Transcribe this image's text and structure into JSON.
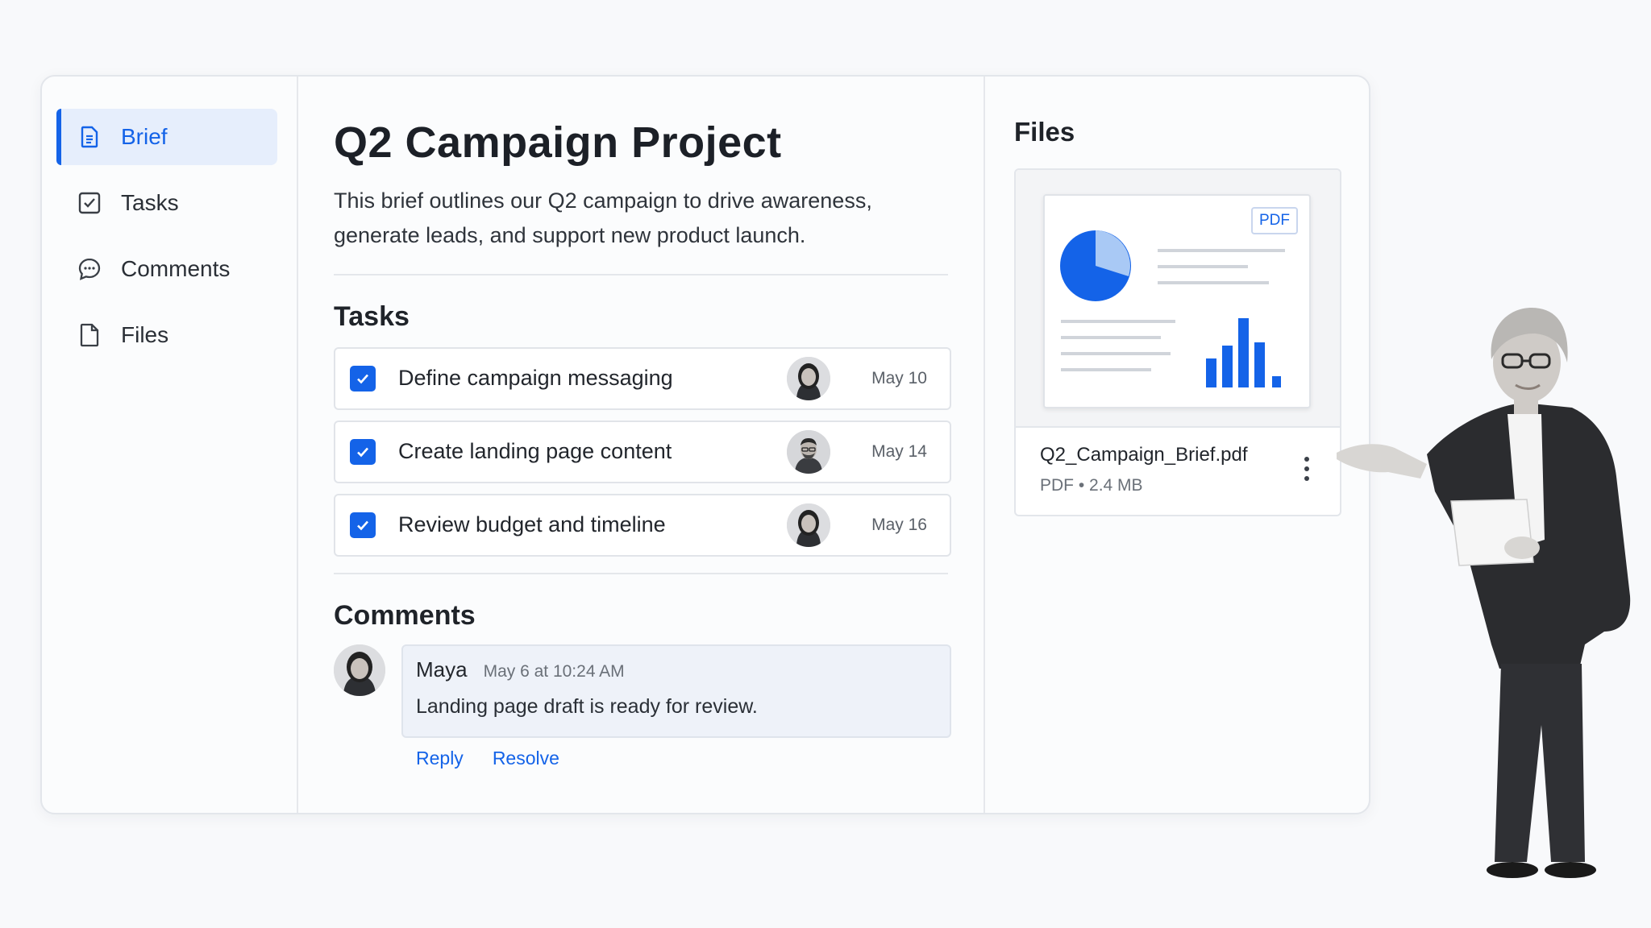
{
  "sidebar": {
    "items": [
      {
        "label": "Brief",
        "icon": "document-icon",
        "active": true
      },
      {
        "label": "Tasks",
        "icon": "checkbox-icon",
        "active": false
      },
      {
        "label": "Comments",
        "icon": "chat-bubble-icon",
        "active": false
      },
      {
        "label": "Files",
        "icon": "file-icon",
        "active": false
      }
    ]
  },
  "main": {
    "title": "Q2 Campaign Project",
    "description": "This brief outlines our Q2 campaign to drive awareness, generate leads, and support new product launch.",
    "tasks_heading": "Tasks",
    "tasks": [
      {
        "label": "Define campaign messaging",
        "date": "May 10",
        "done": true,
        "avatar": "woman-avatar"
      },
      {
        "label": "Create landing page content",
        "date": "May 14",
        "done": true,
        "avatar": "man-avatar"
      },
      {
        "label": "Review budget and timeline",
        "date": "May 16",
        "done": true,
        "avatar": "woman-avatar"
      }
    ],
    "comments_heading": "Comments",
    "comment": {
      "author": "Maya",
      "time": "May 6 at 10:24 AM",
      "text": "Landing page draft is ready for review.",
      "reply_label": "Reply",
      "resolve_label": "Resolve"
    }
  },
  "files": {
    "heading": "Files",
    "file": {
      "name": "Q2_Campaign_Brief.pdf",
      "meta": "PDF • 2.4 MB",
      "badge": "PDF"
    }
  },
  "colors": {
    "accent": "#1463e8",
    "accent_light": "#a9c9f5",
    "active_bg": "#e6eefc"
  }
}
